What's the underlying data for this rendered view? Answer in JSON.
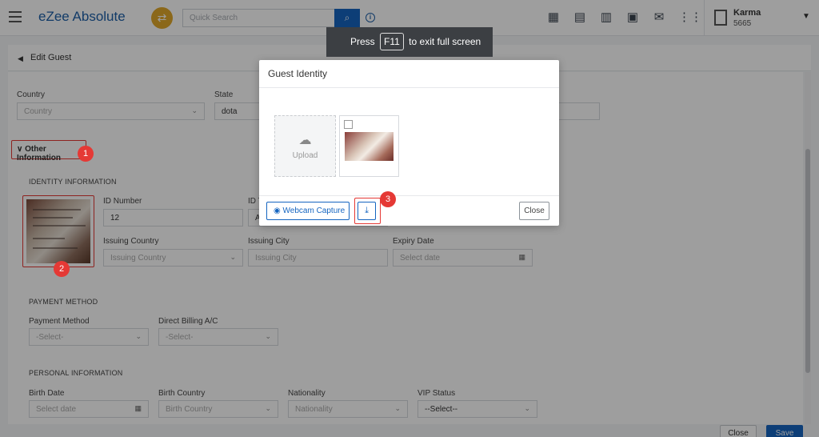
{
  "topbar": {
    "brand": "eZee Absolute",
    "search_placeholder": "Quick Search",
    "user_name": "Karma",
    "user_code": "5665"
  },
  "toast": {
    "prefix": "Press",
    "key": "F11",
    "suffix": "to exit full screen"
  },
  "subheader": {
    "title": "Edit Guest"
  },
  "form": {
    "country_label": "Country",
    "country_value": "Country",
    "state_label": "State",
    "state_value": "dota",
    "other_info_label": "Other Information",
    "identity_section": "IDENTITY INFORMATION",
    "id_number_label": "ID Number",
    "id_number_value": "12",
    "id_type_label": "ID T",
    "id_type_value": "A",
    "issuing_country_label": "Issuing Country",
    "issuing_country_value": "Issuing Country",
    "issuing_city_label": "Issuing City",
    "issuing_city_value": "Issuing City",
    "expiry_label": "Expiry Date",
    "expiry_value": "Select date",
    "payment_section": "PAYMENT METHOD",
    "payment_method_label": "Payment Method",
    "payment_method_value": "-Select-",
    "direct_billing_label": "Direct Billing A/C",
    "direct_billing_value": "-Select-",
    "personal_section": "PERSONAL INFORMATION",
    "birth_date_label": "Birth Date",
    "birth_date_value": "Select date",
    "birth_country_label": "Birth Country",
    "birth_country_value": "Birth Country",
    "nationality_label": "Nationality",
    "nationality_value": "Nationality",
    "vip_label": "VIP Status",
    "vip_value": "--Select--"
  },
  "footer": {
    "close": "Close",
    "save": "Save"
  },
  "modal": {
    "title": "Guest Identity",
    "upload_label": "Upload",
    "webcam_label": "Webcam Capture",
    "close_label": "Close"
  },
  "badges": {
    "b1": "1",
    "b2": "2",
    "b3": "3"
  },
  "colors": {
    "primary": "#1565c0",
    "annotation": "#e53935",
    "accent": "#e0a92a"
  }
}
